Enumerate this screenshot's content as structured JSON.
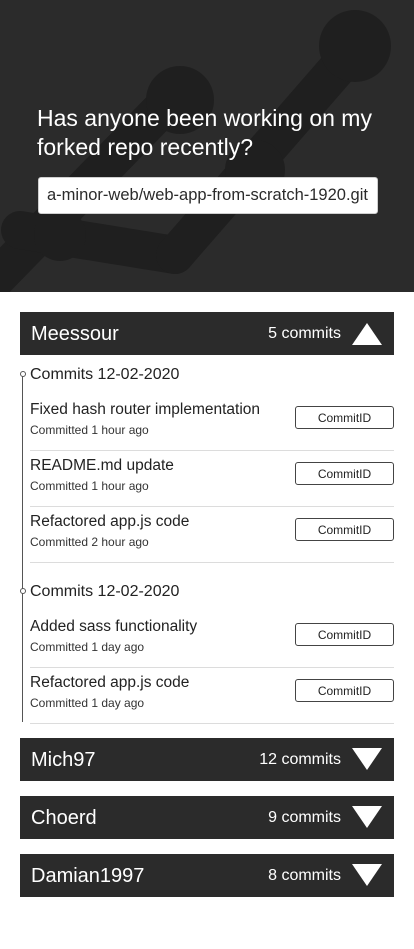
{
  "hero": {
    "question": "Has anyone been working on my forked repo recently?",
    "repo_value": "a-minor-web/web-app-from-scratch-1920.git",
    "repo_placeholder": ""
  },
  "colors": {
    "dark": "#2b2b2b",
    "hero_graphic": "#1f1f1f",
    "white": "#ffffff"
  },
  "users": [
    {
      "name": "Meessour",
      "commits_label": "5 commits",
      "expanded": true,
      "chevron_icon": "chevron-up-icon",
      "groups": [
        {
          "header": "Commits 12-02-2020",
          "commits": [
            {
              "message": "Fixed hash router implementation",
              "time": "Committed 1 hour ago",
              "button": "CommitID"
            },
            {
              "message": "README.md update",
              "time": "Committed 1 hour ago",
              "button": "CommitID"
            },
            {
              "message": "Refactored app.js code",
              "time": "Committed 2 hour ago",
              "button": "CommitID"
            }
          ]
        },
        {
          "header": "Commits 12-02-2020",
          "commits": [
            {
              "message": "Added sass functionality",
              "time": "Committed 1 day ago",
              "button": "CommitID"
            },
            {
              "message": "Refactored app.js code",
              "time": "Committed 1 day ago",
              "button": "CommitID"
            }
          ]
        }
      ]
    },
    {
      "name": "Mich97",
      "commits_label": "12 commits",
      "expanded": false,
      "chevron_icon": "chevron-down-icon"
    },
    {
      "name": "Choerd",
      "commits_label": "9 commits",
      "expanded": false,
      "chevron_icon": "chevron-down-icon"
    },
    {
      "name": "Damian1997",
      "commits_label": "8 commits",
      "expanded": false,
      "chevron_icon": "chevron-down-icon"
    }
  ]
}
